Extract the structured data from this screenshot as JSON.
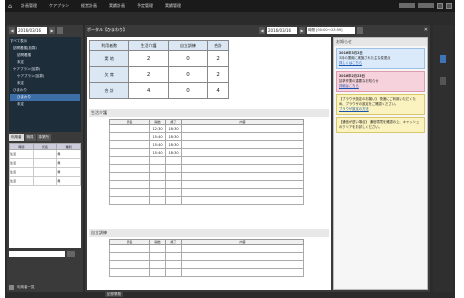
{
  "menubar": {
    "home_icon": "home-icon",
    "items": [
      "計画管理",
      "ケアプラン",
      "経営計画",
      "実績計画",
      "予定管理",
      "実績管理"
    ]
  },
  "left": {
    "date": "2016/03/16",
    "tree": [
      "すべて表示",
      "訪問看護(加算)",
      "訪問看護",
      "未定",
      "ケアプラン(加算)",
      "ケアプラン(加算)",
      "未定",
      "ひまわり",
      "ひまわり",
      "未定"
    ],
    "tabs": [
      "利用者",
      "職員",
      "事業所"
    ],
    "mini_headers": [
      "時間",
      "氏名",
      "種別"
    ],
    "mini_rows": [
      [
        "生活",
        "",
        "無"
      ],
      [
        "生活",
        "",
        "無"
      ],
      [
        "生活",
        "",
        "無"
      ],
      [
        "生活",
        "",
        "無"
      ]
    ],
    "filter_placeholder": "",
    "footer_label": "利用者一覧"
  },
  "main": {
    "title": "ポータル【ひまわり】",
    "date": "2016/03/16",
    "time_range": "時間 [00:00～23:59]",
    "summary": {
      "headers": [
        "利用者数",
        "生活介護",
        "自立訓練",
        "合計"
      ],
      "rows": [
        {
          "label": "実 地",
          "values": [
            "2",
            "0",
            "2"
          ]
        },
        {
          "label": "欠 席",
          "values": [
            "2",
            "0",
            "2"
          ]
        },
        {
          "label": "合 計",
          "values": [
            "4",
            "0",
            "4"
          ]
        }
      ]
    },
    "section1": {
      "title": "生活介護",
      "headers": [
        "氏名",
        "開始",
        "終了",
        "内容"
      ],
      "rows": [
        [
          "",
          "12:30",
          "18:30",
          ""
        ],
        [
          "",
          "15:40",
          "18:30",
          ""
        ],
        [
          "",
          "15:40",
          "18:30",
          ""
        ],
        [
          "",
          "15:40",
          "18:30",
          ""
        ]
      ]
    },
    "section2": {
      "title": "自立訓練",
      "headers": [
        "氏名",
        "開始",
        "終了",
        "内容"
      ]
    },
    "notices": {
      "title": "お知らせ",
      "blocks": [
        {
          "color": "blue",
          "date": "2016年3月2日",
          "text": "3月の運用に実施された主な変更点",
          "link": "詳しくはこちら"
        },
        {
          "color": "pink",
          "date": "2016年2月23日",
          "text": "請求作業の重要なお知らせ",
          "link": "詳細はこちら"
        },
        {
          "color": "yellow",
          "date": "",
          "text": "【ブラウザ設定のお願い】 快適にご利用いただくため、ブラウザの設定をご確認ください。",
          "link": "ブラウザ設定の方法"
        },
        {
          "color": "yellow",
          "date": "",
          "text": "【通信が遅い場合】 通信環境を確認の上、キャッシュのクリアをお試しください。",
          "link": ""
        }
      ]
    },
    "footer_tag": "記録業務"
  }
}
